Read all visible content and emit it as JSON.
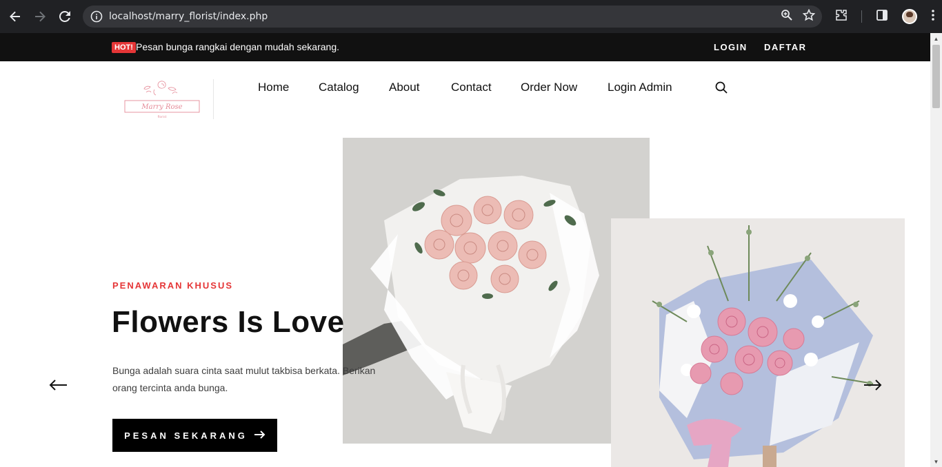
{
  "browser": {
    "url": "localhost/marry_florist/index.php",
    "icons": [
      "back-icon",
      "forward-icon",
      "reload-icon",
      "site-info-icon",
      "zoom-icon",
      "bookmark-star-icon",
      "extensions-icon",
      "side-panel-icon",
      "profile-avatar",
      "menu-icon"
    ]
  },
  "topbar": {
    "hot_badge": "HOT!",
    "promo_text": "Pesan bunga rangkai dengan mudah sekarang.",
    "login_label": "LOGIN",
    "register_label": "DAFTAR"
  },
  "header": {
    "logo_text": "Marry Rose",
    "logo_subtext": "florist",
    "nav": [
      "Home",
      "Catalog",
      "About",
      "Contact",
      "Order Now",
      "Login Admin"
    ]
  },
  "hero": {
    "kicker": "PENAWARAN KHUSUS",
    "title": "Flowers Is Love",
    "description": "Bunga adalah suara cinta saat mulut takbisa berkata. Berikan orang tercinta anda bunga.",
    "cta_label": "PESAN SEKARANG",
    "cta_arrow": "➜"
  },
  "colors": {
    "accent": "#e53637",
    "topbar_bg": "#111111",
    "text_dark": "#111111",
    "chrome_bg": "#202124"
  }
}
